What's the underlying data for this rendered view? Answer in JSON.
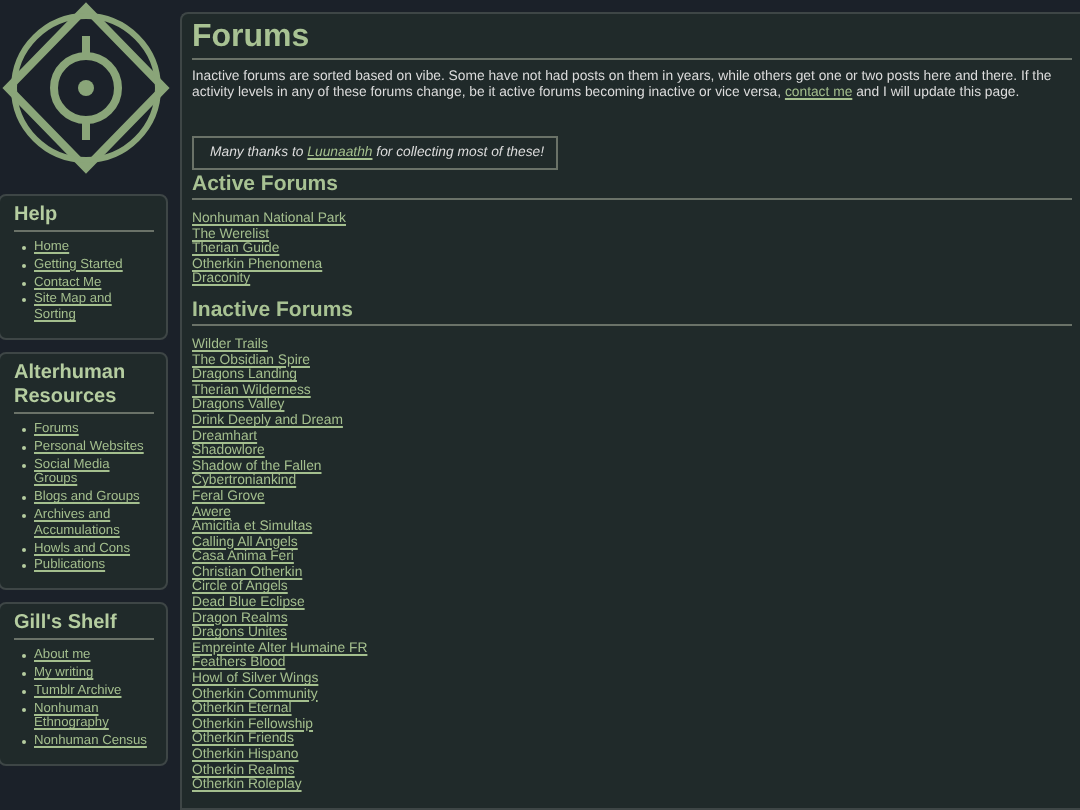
{
  "sidebar": [
    {
      "title": "Help",
      "links": [
        "Home",
        "Getting Started",
        "Contact Me",
        "Site Map and Sorting"
      ]
    },
    {
      "title": "Alterhuman Resources",
      "links": [
        "Forums",
        "Personal Websites",
        "Social Media Groups",
        "Blogs and Groups",
        "Archives and Accumulations",
        "Howls and Cons",
        "Publications"
      ]
    },
    {
      "title": "Gill's Shelf",
      "links": [
        "About me",
        "My writing",
        "Tumblr Archive",
        "Nonhuman Ethnography",
        "Nonhuman Census"
      ]
    }
  ],
  "main": {
    "title": "Forums",
    "intro": {
      "before": "Inactive forums are sorted based on vibe. Some have not had posts on them in years, while others get one or two posts here and there. If the activity levels in any of these forums change, be it active forums becoming inactive or vice versa,",
      "link": "contact me",
      "after": "and I will update this page."
    },
    "thanks": {
      "before": "Many thanks to",
      "link": "Luunaathh",
      "after": "for collecting most of these!"
    },
    "sections": [
      {
        "title": "Active Forums",
        "links": [
          "Nonhuman National Park",
          "The Werelist",
          "Therian Guide",
          "Otherkin Phenomena",
          "Draconity"
        ]
      },
      {
        "title": "Inactive Forums",
        "links": [
          "Wilder Trails",
          "The Obsidian Spire",
          "Dragons Landing",
          "Therian Wilderness",
          "Dragons Valley",
          "Drink Deeply and Dream",
          "Dreamhart",
          "Shadowlore",
          "Shadow of the Fallen",
          "Cybertroniankind",
          "Feral Grove",
          "Awere",
          "Amicitia et Simultas",
          "Calling All Angels",
          "Casa Anima Feri",
          "Christian Otherkin",
          "Circle of Angels",
          "Dead Blue Eclipse",
          "Dragon Realms",
          "Dragons Unites",
          "Empreinte Alter Humaine FR",
          "Feathers Blood",
          "Howl of Silver Wings",
          "Otherkin Community",
          "Otherkin Eternal",
          "Otherkin Fellowship",
          "Otherkin Friends",
          "Otherkin Hispano",
          "Otherkin Realms",
          "Otherkin Roleplay"
        ]
      }
    ]
  }
}
